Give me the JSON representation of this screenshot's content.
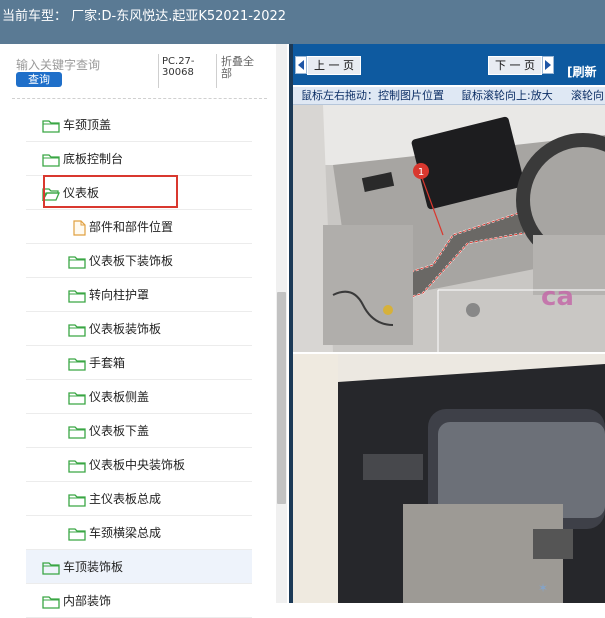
{
  "header": {
    "title": "当前车型：   厂家:D-东风悦达.起亚K52021-2022"
  },
  "search": {
    "placeholder": "输入关键字查询",
    "button_label": "查询"
  },
  "code": {
    "line1": "PC.27-",
    "line2": "30068"
  },
  "collapse_label": "折叠全部",
  "tree": {
    "items": [
      {
        "label": "车颈顶盖",
        "icon": "folder-icon"
      },
      {
        "label": "底板控制台",
        "icon": "folder-icon"
      },
      {
        "label": "仪表板",
        "icon": "folder-open-icon",
        "selected": true
      },
      {
        "label": "部件和部件位置",
        "icon": "document-icon"
      },
      {
        "label": "仪表板下装饰板",
        "icon": "folder-icon"
      },
      {
        "label": "转向柱护罩",
        "icon": "folder-icon"
      },
      {
        "label": "仪表板装饰板",
        "icon": "folder-icon"
      },
      {
        "label": "手套箱",
        "icon": "folder-icon"
      },
      {
        "label": "仪表板侧盖",
        "icon": "folder-icon"
      },
      {
        "label": "仪表板下盖",
        "icon": "folder-icon"
      },
      {
        "label": "仪表板中央装饰板",
        "icon": "folder-icon"
      },
      {
        "label": "主仪表板总成",
        "icon": "folder-icon"
      },
      {
        "label": "车颈横梁总成",
        "icon": "folder-icon"
      },
      {
        "label": "车顶装饰板",
        "icon": "folder-icon"
      },
      {
        "label": "内部装饰",
        "icon": "folder-icon"
      }
    ]
  },
  "viewer": {
    "prev_label": "上 一 页",
    "next_label": "下 一 页",
    "refresh_label": "[刷新",
    "hints": [
      "鼠标左右拖动：控制图片位置",
      "鼠标滚轮向上:放大",
      "滚轮向"
    ],
    "callout_number": "1",
    "watermark_text": "ca"
  },
  "colors": {
    "header_bg": "#5a7a94",
    "nav_bg": "#0e5aa0",
    "selection_border": "#d9382f",
    "query_button": "#1f6fc9",
    "folder": "#3aa644"
  }
}
